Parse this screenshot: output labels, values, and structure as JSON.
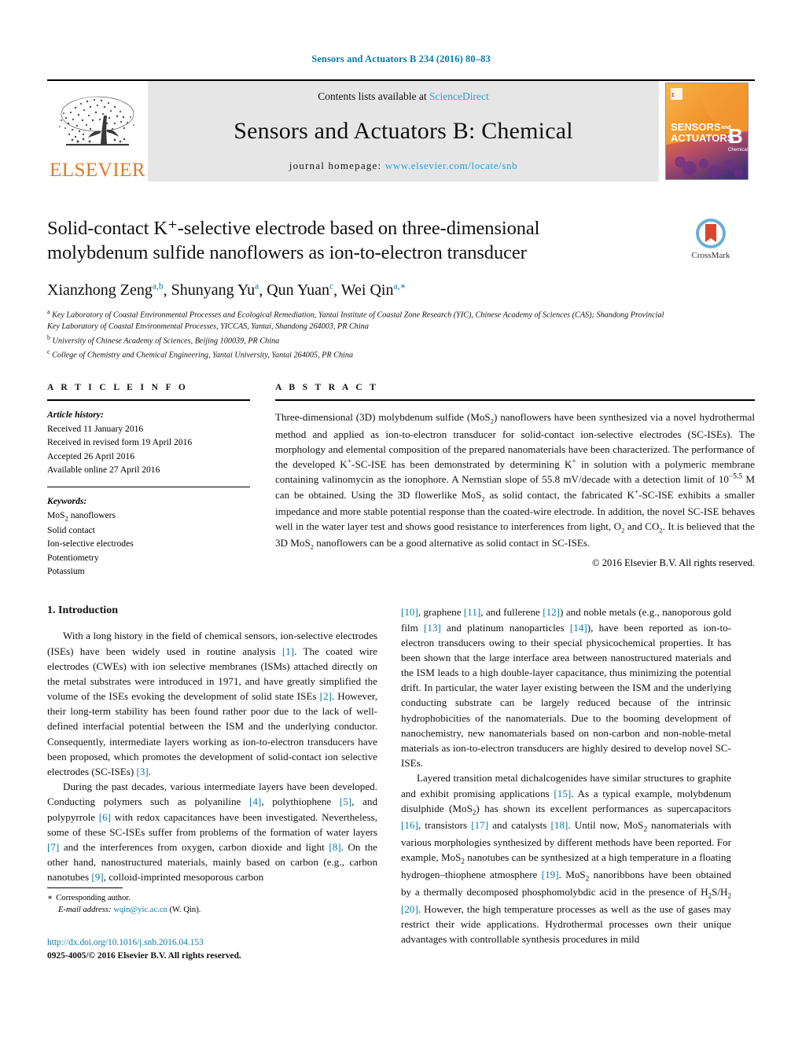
{
  "running_head": "Sensors and Actuators B 234 (2016) 80–83",
  "masthead": {
    "publisher": "ELSEVIER",
    "contents_prefix": "Contents lists available at ",
    "contents_link": "ScienceDirect",
    "journal_title": "Sensors and Actuators B: Chemical",
    "homepage_prefix": "journal homepage: ",
    "homepage_url": "www.elsevier.com/locate/snb",
    "cover_line1": "SENSORS",
    "cover_and": "and",
    "cover_line2": "ACTUATORS",
    "cover_letter": "B",
    "cover_sub": "Chemical"
  },
  "crossmark": {
    "label": "CrossMark"
  },
  "article": {
    "title_line1": "Solid-contact K⁺-selective electrode based on three-dimensional",
    "title_line2": "molybdenum sulfide nanoflowers as ion-to-electron transducer",
    "authors": [
      {
        "name": "Xianzhong Zeng",
        "marks": "a,b"
      },
      {
        "name": "Shunyang Yu",
        "marks": "a"
      },
      {
        "name": "Qun Yuan",
        "marks": "c"
      },
      {
        "name": "Wei Qin",
        "marks": "a,∗"
      }
    ],
    "affiliations": [
      {
        "mark": "a",
        "text": "Key Laboratory of Coastal Environmental Processes and Ecological Remediation, Yantai Institute of Coastal Zone Research (YIC), Chinese Academy of Sciences (CAS); Shandong Provincial Key Laboratory of Coastal Environmental Processes, YICCAS, Yantai, Shandong 264003, PR China"
      },
      {
        "mark": "b",
        "text": "University of Chinese Academy of Sciences, Beijing 100039, PR China"
      },
      {
        "mark": "c",
        "text": "College of Chemistry and Chemical Engineering, Yantai University, Yantai 264005, PR China"
      }
    ]
  },
  "info": {
    "heading": "A R T I C L E    I N F O",
    "history_label": "Article history:",
    "history": [
      "Received 11 January 2016",
      "Received in revised form 19 April 2016",
      "Accepted 26 April 2016",
      "Available online 27 April 2016"
    ],
    "keywords_label": "Keywords:",
    "keywords": [
      "MoS2 nanoflowers",
      "Solid contact",
      "Ion-selective electrodes",
      "Potentiometry",
      "Potassium"
    ]
  },
  "abstract": {
    "heading": "A B S T R A C T",
    "text": "Three-dimensional (3D) molybdenum sulfide (MoS2) nanoflowers have been synthesized via a novel hydrothermal method and applied as ion-to-electron transducer for solid-contact ion-selective electrodes (SC-ISEs). The morphology and elemental composition of the prepared nanomaterials have been characterized. The performance of the developed K+-SC-ISE has been demonstrated by determining K+ in solution with a polymeric membrane containing valinomycin as the ionophore. A Nernstian slope of 55.8 mV/decade with a detection limit of 10−5.5 M can be obtained. Using the 3D flowerlike MoS2 as solid contact, the fabricated K+-SC-ISE exhibits a smaller impedance and more stable potential response than the coated-wire electrode. In addition, the novel SC-ISE behaves well in the water layer test and shows good resistance to interferences from light, O2 and CO2. It is believed that the 3D MoS2 nanoflowers can be a good alternative as solid contact in SC-ISEs.",
    "copyright": "© 2016 Elsevier B.V. All rights reserved."
  },
  "introduction": {
    "heading": "1.  Introduction",
    "left_paragraphs": [
      "With a long history in the field of chemical sensors, ion-selective electrodes (ISEs) have been widely used in routine analysis [1]. The coated wire electrodes (CWEs) with ion selective membranes (ISMs) attached directly on the metal substrates were introduced in 1971, and have greatly simplified the volume of the ISEs evoking the development of solid state ISEs [2]. However, their long-term stability has been found rather poor due to the lack of well-defined interfacial potential between the ISM and the underlying conductor. Consequently, intermediate layers working as ion-to-electron transducers have been proposed, which promotes the development of solid-contact ion selective electrodes (SC-ISEs) [3].",
      "During the past decades, various intermediate layers have been developed. Conducting polymers such as polyaniline [4], polythiophene [5], and polypyrrole [6] with redox capacitances have been investigated. Nevertheless, some of these SC-ISEs suffer from problems of the formation of water layers [7] and the interferences from oxygen, carbon dioxide and light [8]. On the other hand, nanostructured materials, mainly based on carbon (e.g., carbon nanotubes [9], colloid-imprinted mesoporous carbon"
    ],
    "right_paragraphs": [
      "[10], graphene [11], and fullerene [12]) and noble metals (e.g., nanoporous gold film [13] and platinum nanoparticles [14]), have been reported as ion-to-electron transducers owing to their special physicochemical properties. It has been shown that the large interface area between nanostructured materials and the ISM leads to a high double-layer capacitance, thus minimizing the potential drift. In particular, the water layer existing between the ISM and the underlying conducting substrate can be largely reduced because of the intrinsic hydrophobicities of the nanomaterials. Due to the booming development of nanochemistry, new nanomaterials based on non-carbon and non-noble-metal materials as ion-to-electron transducers are highly desired to develop novel SC-ISEs.",
      "Layered transition metal dichalcogenides have similar structures to graphite and exhibit promising applications [15]. As a typical example, molybdenum disulphide (MoS2) has shown its excellent performances as supercapacitors [16], transistors [17] and catalysts [18]. Until now, MoS2 nanomaterials with various morphologies synthesized by different methods have been reported. For example, MoS2 nanotubes can be synthesized at a high temperature in a floating hydrogen–thiophene atmosphere [19]. MoS2 nanoribbons have been obtained by a thermally decomposed phosphomolybdic acid in the presence of H2S/H2 [20]. However, the high temperature processes as well as the use of gases may restrict their wide applications. Hydrothermal processes own their unique advantages with controllable synthesis procedures in mild"
    ]
  },
  "footnote": {
    "star": "∗",
    "corresponding": "Corresponding author.",
    "email_label": "E-mail address:",
    "email": "wqin@yic.ac.cn",
    "email_suffix": "(W. Qin)."
  },
  "doi_block": {
    "doi": "http://dx.doi.org/10.1016/j.snb.2016.04.153",
    "issn_line": "0925-4005/© 2016 Elsevier B.V. All rights reserved."
  },
  "colors": {
    "link_blue": "#0b7aa8",
    "sciencedirect_blue": "#2a9fd6",
    "elsevier_orange": "#E87722",
    "masthead_grey": "#e6e6e6"
  }
}
